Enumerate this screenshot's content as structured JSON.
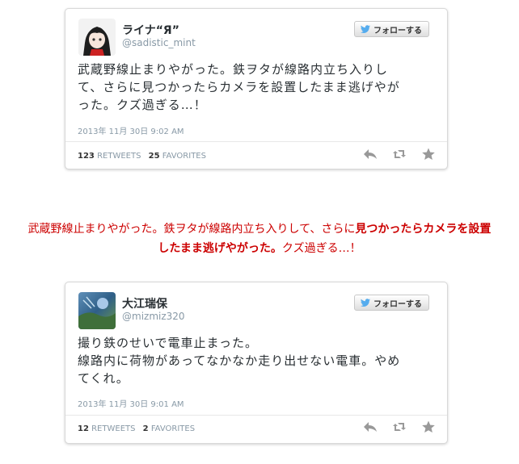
{
  "tweets": [
    {
      "name": "ライナ“Я”",
      "handle": "@sadistic_mint",
      "follow_label": "フォローする",
      "text_lines": [
        "武蔵野線止まりやがった。鉄ヲタが線路内立ち入りし",
        "て、さらに見つかったらカメラを設置したまま逃げやが",
        "った。クズ過ぎる…！"
      ],
      "date": "2013年 11月 30日  9:02 AM",
      "retweets": "123",
      "retweets_label": "RETWEETS",
      "favorites": "25",
      "favorites_label": "FAVORITES"
    },
    {
      "name": "大江瑞保",
      "handle": "@mizmiz320",
      "follow_label": "フォローする",
      "text_lines": [
        "撮り鉄のせいで電車止まった。",
        "線路内に荷物があってなかなか走り出せない電車。やめ",
        "てくれ。"
      ],
      "date": "2013年 11月 30日  9:01 AM",
      "retweets": "12",
      "retweets_label": "RETWEETS",
      "favorites": "2",
      "favorites_label": "FAVORITES"
    }
  ],
  "quote": {
    "line1_part1": "武蔵野線止まりやがった。鉄ヲタが線路内立ち入りして、さらに",
    "line1_part2": "見つかったらカメラを設置",
    "line2_part1": "したまま逃げやがった。",
    "line2_part2": "クズ過ぎる…！"
  },
  "colors": {
    "accent_red": "#cc0000",
    "twitter_blue": "#55acee",
    "meta_gray": "#8899a6",
    "action_gray": "#999999"
  },
  "icons": [
    "twitter-bird-icon",
    "reply-icon",
    "retweet-icon",
    "favorite-star-icon"
  ]
}
